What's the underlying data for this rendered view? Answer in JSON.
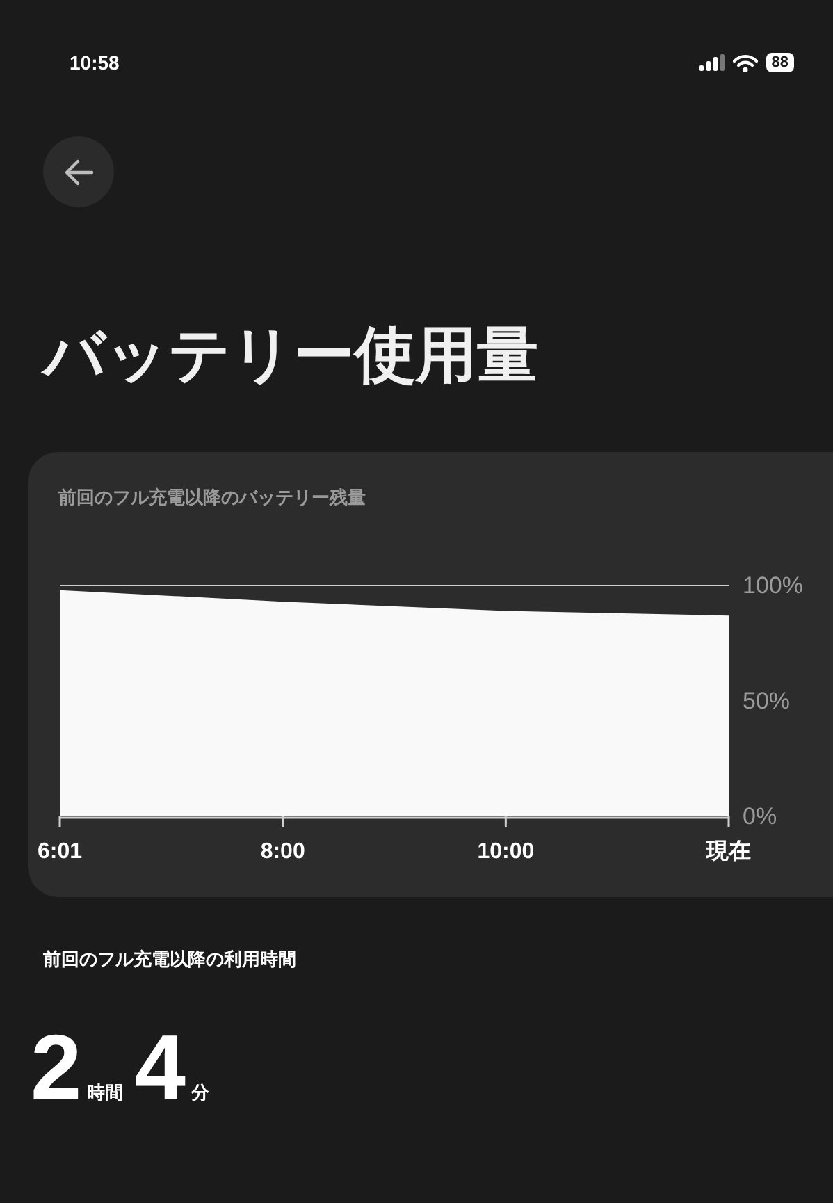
{
  "status_bar": {
    "time": "10:58",
    "battery": "88"
  },
  "title": "バッテリー使用量",
  "battery_card": {
    "chart_data": {
      "type": "area",
      "title": "前回のフル充電以降のバッテリー残量",
      "x": [
        "6:01",
        "8:00",
        "10:00",
        "現在"
      ],
      "series": [
        {
          "color": "#f9f9f9",
          "values": [
            98,
            93,
            89,
            87
          ]
        }
      ],
      "ylim": [
        0,
        100
      ],
      "yticks": [
        {
          "value": 0,
          "label": "0%"
        },
        {
          "value": 50,
          "label": "50%"
        },
        {
          "value": 100,
          "label": "100%"
        }
      ]
    }
  },
  "usage": {
    "heading": "前回のフル充電以降の利用時間",
    "hours": "2",
    "hours_unit": "時間",
    "minutes": "4",
    "minutes_unit": "分"
  }
}
